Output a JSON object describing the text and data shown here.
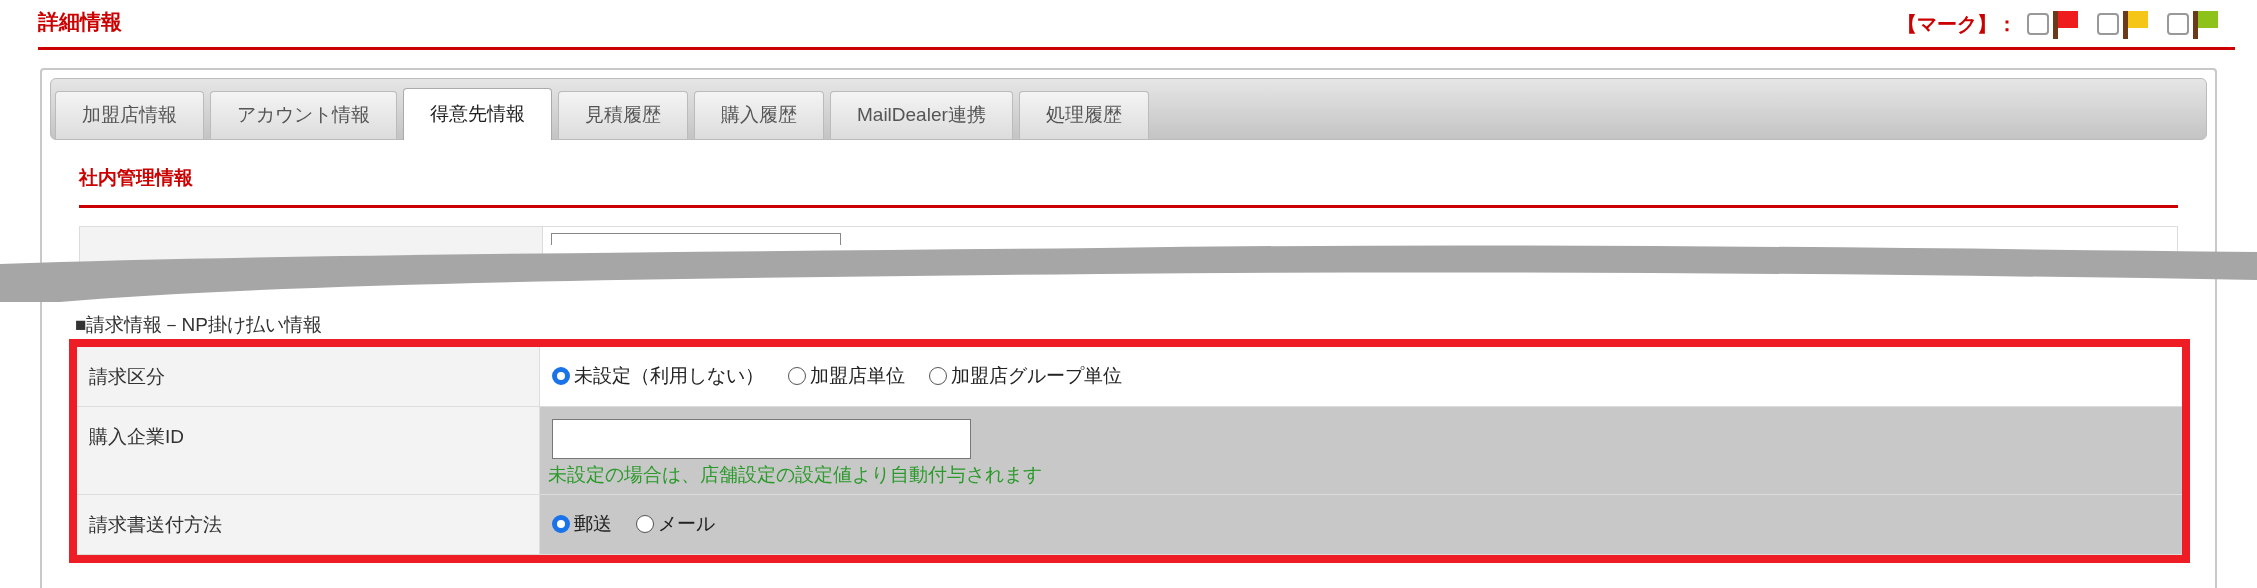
{
  "header": {
    "title": "詳細情報",
    "mark_label": "【マーク】：",
    "marks": [
      {
        "checked": false,
        "color": "#ee1c1c"
      },
      {
        "checked": false,
        "color": "#f5c518"
      },
      {
        "checked": false,
        "color": "#8cc21a"
      }
    ]
  },
  "tabs": [
    {
      "label": "加盟店情報",
      "selected": false
    },
    {
      "label": "アカウント情報",
      "selected": false
    },
    {
      "label": "得意先情報",
      "selected": true
    },
    {
      "label": "見積履歴",
      "selected": false
    },
    {
      "label": "購入履歴",
      "selected": false
    },
    {
      "label": "MailDealer連携",
      "selected": false
    },
    {
      "label": "処理履歴",
      "selected": false
    }
  ],
  "section": {
    "title": "社内管理情報"
  },
  "billing": {
    "title": "■請求情報－NP掛け払い情報",
    "rows": [
      {
        "kind": "radio",
        "label": "請求区分",
        "shaded": false,
        "options": [
          {
            "label": "未設定（利用しない）",
            "selected": true
          },
          {
            "label": "加盟店単位",
            "selected": false
          },
          {
            "label": "加盟店グループ単位",
            "selected": false
          }
        ]
      },
      {
        "kind": "input",
        "label": "購入企業ID",
        "shaded": true,
        "hint": "未設定の場合は、店舗設定の設定値より自動付与されます"
      },
      {
        "kind": "radio",
        "label": "請求書送付方法",
        "shaded": true,
        "options": [
          {
            "label": "郵送",
            "selected": true
          },
          {
            "label": "メール",
            "selected": false
          }
        ]
      }
    ]
  }
}
